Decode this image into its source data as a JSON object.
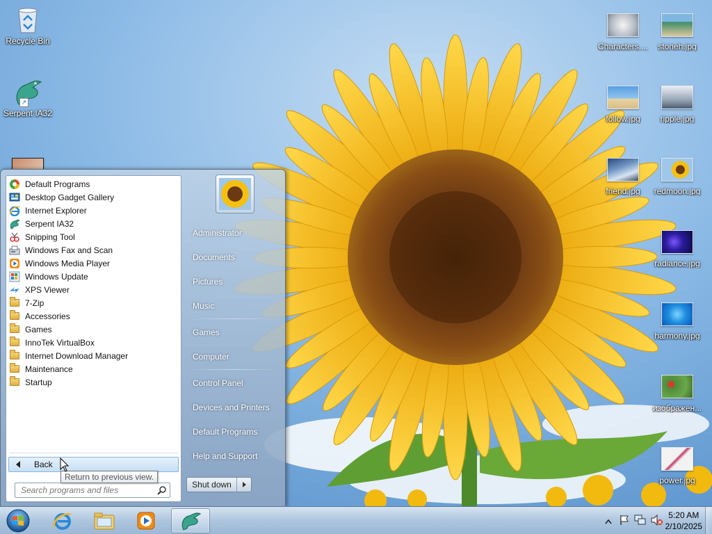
{
  "desktop": {
    "icons_left": [
      {
        "label": "Recycle Bin",
        "icon": "recycle-bin-icon"
      },
      {
        "label": "Serpent IA32",
        "icon": "serpent-dragon-icon"
      }
    ],
    "icons_right": [
      {
        "label": "Characters....",
        "icon": "image-thumbnail-icon"
      },
      {
        "label": "stoneh.jpg",
        "icon": "image-thumbnail-icon"
      },
      {
        "label": "follow.jpg",
        "icon": "image-thumbnail-icon"
      },
      {
        "label": "ripple.jpg",
        "icon": "image-thumbnail-icon"
      },
      {
        "label": "friend.jpg",
        "icon": "image-thumbnail-icon"
      },
      {
        "label": "redmoon.jpg",
        "icon": "image-thumbnail-icon"
      },
      {
        "label": "radiance.jpg",
        "icon": "image-thumbnail-icon"
      },
      {
        "label": "harmony.jpg",
        "icon": "image-thumbnail-icon"
      },
      {
        "label": "изображен...",
        "icon": "image-thumbnail-icon"
      },
      {
        "label": "power.jpg",
        "icon": "image-thumbnail-icon"
      }
    ]
  },
  "start_menu": {
    "programs": [
      {
        "label": "Default Programs",
        "icon": "default-programs-icon"
      },
      {
        "label": "Desktop Gadget Gallery",
        "icon": "gadget-gallery-icon"
      },
      {
        "label": "Internet Explorer",
        "icon": "internet-explorer-icon"
      },
      {
        "label": "Serpent IA32",
        "icon": "serpent-dragon-icon"
      },
      {
        "label": "Snipping Tool",
        "icon": "scissors-icon"
      },
      {
        "label": "Windows Fax and Scan",
        "icon": "fax-icon"
      },
      {
        "label": "Windows Media Player",
        "icon": "media-player-icon"
      },
      {
        "label": "Windows Update",
        "icon": "windows-update-icon"
      },
      {
        "label": "XPS Viewer",
        "icon": "xps-viewer-icon"
      },
      {
        "label": "7-Zip",
        "icon": "folder-icon"
      },
      {
        "label": "Accessories",
        "icon": "folder-icon"
      },
      {
        "label": "Games",
        "icon": "folder-icon"
      },
      {
        "label": "InnoTek VirtualBox",
        "icon": "folder-icon"
      },
      {
        "label": "Internet Download Manager",
        "icon": "folder-icon"
      },
      {
        "label": "Maintenance",
        "icon": "folder-icon"
      },
      {
        "label": "Startup",
        "icon": "folder-icon"
      }
    ],
    "back_label": "Back",
    "search_placeholder": "Search programs and files",
    "tooltip": "Return to previous view.",
    "right_links": [
      "Administrator",
      "Documents",
      "Pictures",
      "Music",
      "Games",
      "Computer",
      "Control Panel",
      "Devices and Printers",
      "Default Programs",
      "Help and Support"
    ],
    "shutdown_label": "Shut down"
  },
  "taskbar": {
    "pinned": [
      {
        "name": "internet-explorer",
        "icon": "internet-explorer-icon"
      },
      {
        "name": "windows-explorer",
        "icon": "folder-library-icon"
      },
      {
        "name": "media-player",
        "icon": "media-player-icon"
      },
      {
        "name": "serpent-ia32",
        "icon": "serpent-dragon-icon",
        "active": true
      }
    ],
    "clock": {
      "time": "5:20 AM",
      "date": "2/10/2025"
    }
  },
  "colors": {
    "accent": "#1c6fbf",
    "sunflower_petal": "#f5c010",
    "sunflower_center": "#6b3a12"
  }
}
